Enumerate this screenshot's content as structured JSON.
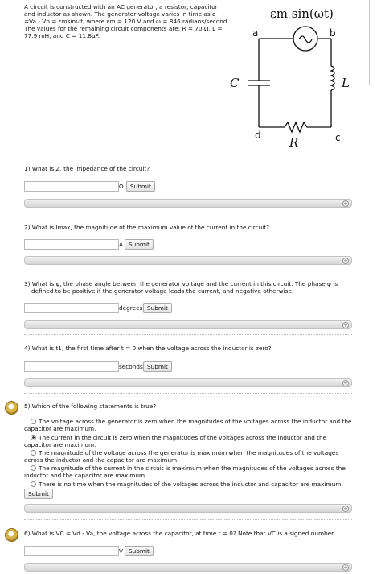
{
  "intro": "A circuit is constructed with an AC generator, a resistor, capacitor and inductor as shown. The generator voltage varies in time as ε =Va - Vb = εmsinωt, where εm = 120 V and ω = 846 radians/second. The values for the remaining circuit components are: R = 70 Ω, L = 77.9 mH, and C = 11.8μF.",
  "circuit": {
    "source": "εm sin(ωt)",
    "a": "a",
    "b": "b",
    "c": "c",
    "d": "d",
    "cap": "C",
    "ind": "L",
    "res": "R"
  },
  "questions": [
    {
      "text": "1) What is Z, the impedance of the circuit?",
      "unit": "Ω",
      "btn": "Submit"
    },
    {
      "text": "2) What is Imax, the magnitude of the maximum value of the current in the circuit?",
      "unit": "A",
      "btn": "Submit"
    },
    {
      "text": "3) What is φ, the phase angle between the generator voltage and the current in this circuit. The phase φ is defined to be positive if the generator voltage leads the current, and negative otherwise.",
      "unit": "degrees",
      "btn": "Submit"
    },
    {
      "text": "4) What is t1, the first time after t = 0 when the voltage across the inductor is zero?",
      "unit": "seconds",
      "btn": "Submit"
    },
    {
      "text": "5) Which of the following statements is true?",
      "btn": "Submit",
      "options": [
        "The voltage across the generator is zero when the magnitudes of the voltages across the inductor and the capacitor are maximum.",
        "The current in the circuit is zero when the magnitudes of the voltages across the inductor and the capacitor are maximum.",
        "The magnitude of the voltage across the generator is maximum when the magnitudes of the voltages across the inductor and the capacitor are maximum.",
        "The magnitude of the current in the circuit is maximum when the magnitudes of the voltages across the inductor and the capacitor are maximum.",
        "There is no time when the magnitudes of the voltages across the inductor and capacitor are maximum."
      ],
      "selected": 1
    },
    {
      "text": "6) What is VC = Vd - Va, the voltage across the capacitor, at time t = 0? Note that VC is a signed number.",
      "unit": "V",
      "btn": "Submit"
    }
  ]
}
